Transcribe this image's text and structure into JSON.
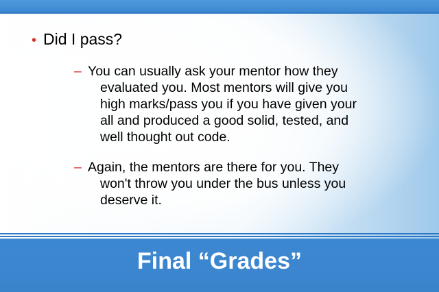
{
  "slide": {
    "title": "Final “Grades”",
    "bullet": "Did I pass?",
    "sub_items": [
      {
        "lines": [
          "You can usually ask your mentor how they",
          "evaluated you.  Most mentors will give you",
          "high marks/pass you if you have given your",
          "all and produced a good solid, tested, and",
          "well thought out code."
        ]
      },
      {
        "lines": [
          "Again, the mentors are there for you.  They",
          "won't throw you under the bus unless you",
          "deserve it."
        ]
      }
    ],
    "colors": {
      "accent": "#d8312d",
      "bar": "#3b86cf",
      "title_text": "#ffffff"
    }
  }
}
